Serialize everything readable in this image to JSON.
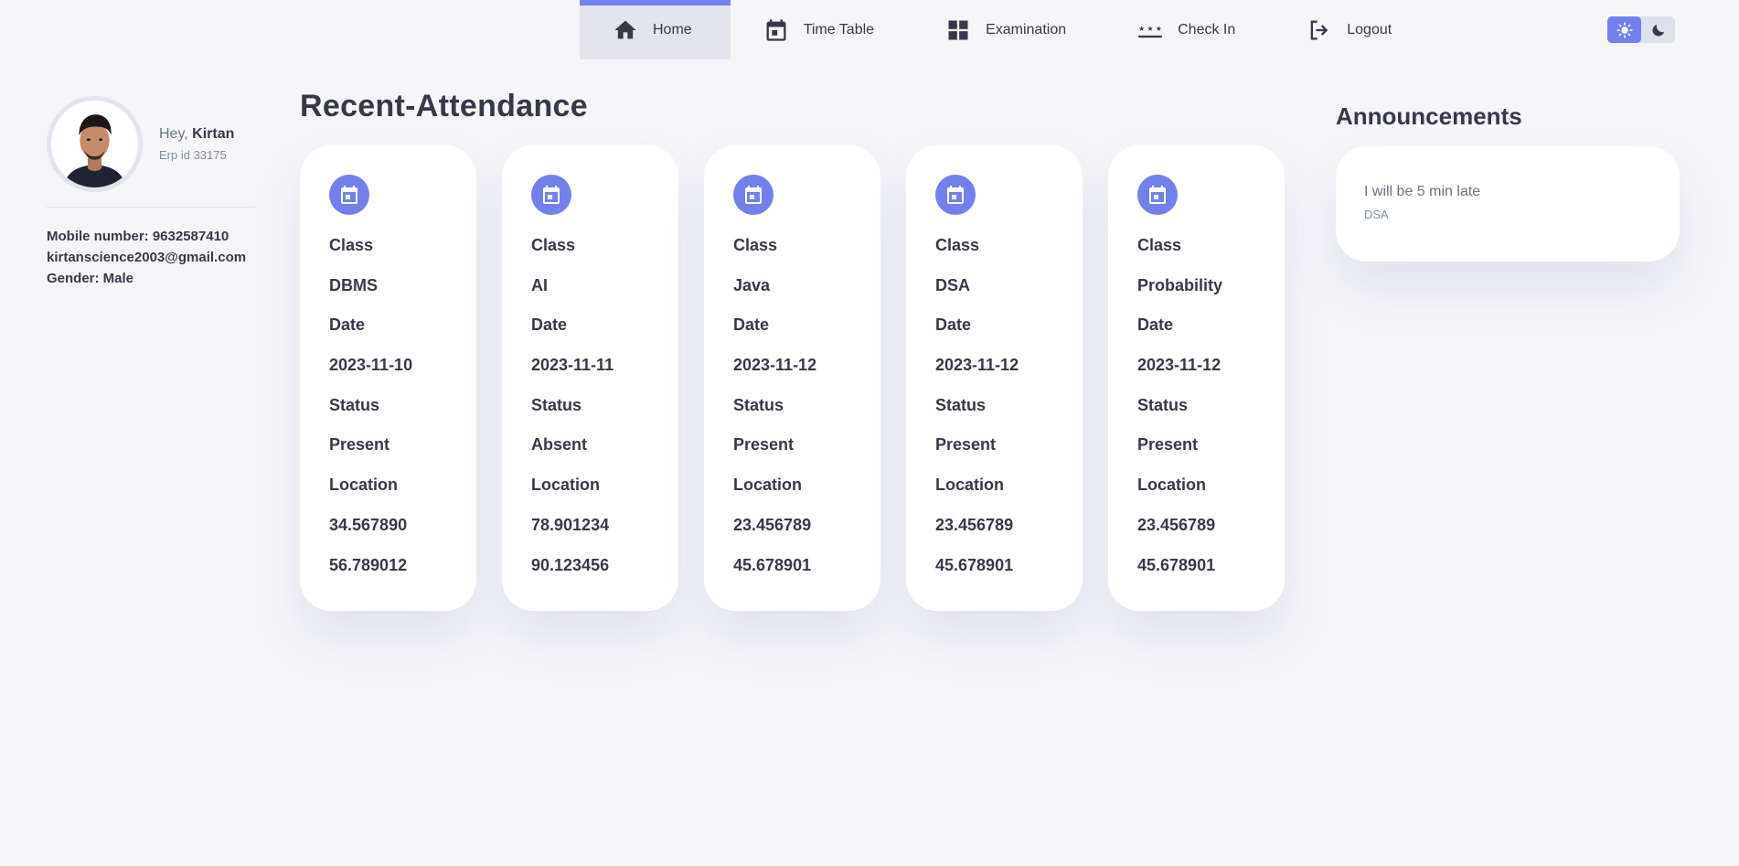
{
  "nav": {
    "items": [
      {
        "label": "Home",
        "icon": "home-icon"
      },
      {
        "label": "Time Table",
        "icon": "calendar-icon"
      },
      {
        "label": "Examination",
        "icon": "grid-icon"
      },
      {
        "label": "Check In",
        "icon": "password-icon"
      },
      {
        "label": "Logout",
        "icon": "logout-icon"
      }
    ],
    "active": "Home",
    "theme": {
      "mode": "light",
      "icons": [
        "sun-icon",
        "moon-icon"
      ]
    }
  },
  "profile": {
    "greeting": "Hey,",
    "name": "Kirtan",
    "erp": "Erp id 33175",
    "mobile": "Mobile number: 9632587410",
    "email": "kirtanscience2003@gmail.com",
    "gender": "Gender: Male"
  },
  "attendance": {
    "title": "Recent-Attendance",
    "labels": {
      "class": "Class",
      "date": "Date",
      "status": "Status",
      "location": "Location"
    },
    "records": [
      {
        "class": "DBMS",
        "date": "2023-11-10",
        "status": "Present",
        "lat": "34.567890",
        "lng": "56.789012"
      },
      {
        "class": "AI",
        "date": "2023-11-11",
        "status": "Absent",
        "lat": "78.901234",
        "lng": "90.123456"
      },
      {
        "class": "Java",
        "date": "2023-11-12",
        "status": "Present",
        "lat": "23.456789",
        "lng": "45.678901"
      },
      {
        "class": "DSA",
        "date": "2023-11-12",
        "status": "Present",
        "lat": "23.456789",
        "lng": "45.678901"
      },
      {
        "class": "Probability",
        "date": "2023-11-12",
        "status": "Present",
        "lat": "23.456789",
        "lng": "45.678901"
      }
    ]
  },
  "announcements": {
    "title": "Announcements",
    "items": [
      {
        "message": "I will be 5 min late",
        "subject": "DSA"
      }
    ]
  },
  "colors": {
    "accent": "#7380ec",
    "text": "#363949",
    "muted": "#677483",
    "background": "#f6f6f9"
  }
}
